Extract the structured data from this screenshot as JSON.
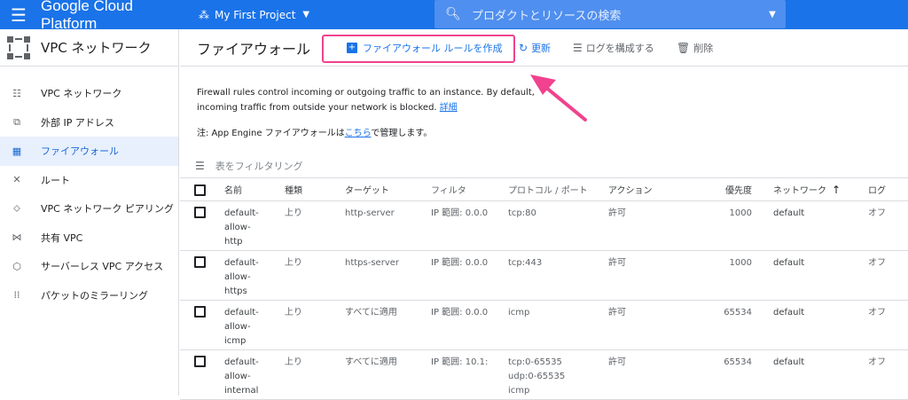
{
  "topbar": {
    "brand": "Google Cloud Platform",
    "project": "My First Project",
    "search_placeholder": "プロダクトとリソースの検索",
    "color": "#1a73e8"
  },
  "sidebar": {
    "title": "VPC ネットワーク",
    "items": [
      {
        "label": "VPC ネットワーク",
        "icon": "network-icon"
      },
      {
        "label": "外部 IP アドレス",
        "icon": "external-ip-icon"
      },
      {
        "label": "ファイアウォール",
        "icon": "firewall-icon"
      },
      {
        "label": "ルート",
        "icon": "route-icon"
      },
      {
        "label": "VPC ネットワーク ピアリング",
        "icon": "peering-icon"
      },
      {
        "label": "共有 VPC",
        "icon": "shared-vpc-icon"
      },
      {
        "label": "サーバーレス VPC アクセス",
        "icon": "serverless-icon"
      },
      {
        "label": "パケットのミラーリング",
        "icon": "mirroring-icon"
      }
    ]
  },
  "toolbar": {
    "title": "ファイアウォール",
    "create": "ファイアウォール ルールを作成",
    "refresh": "更新",
    "logs": "ログを構成する",
    "delete": "削除"
  },
  "info": {
    "text": "Firewall rules control incoming or outgoing traffic to an instance. By default, incoming traffic from outside your network is blocked.",
    "link": "詳細",
    "note_prefix": "注: App Engine ファイアウォールは",
    "note_link": "こちら",
    "note_suffix": "で管理します。"
  },
  "filter": {
    "placeholder": "表をフィルタリング"
  },
  "table": {
    "headers": [
      "名前",
      "種類",
      "ターゲット",
      "フィルタ",
      "プロトコル / ポート",
      "アクション",
      "優先度",
      "ネットワーク",
      "ログ"
    ],
    "rows": [
      {
        "name1": "default-",
        "name2": "allow-",
        "name3": "http",
        "type": "上り",
        "target": "http-server",
        "filter": "IP 範囲: 0.0.0",
        "proto1": "tcp:80",
        "proto2": "",
        "proto3": "",
        "action": "許可",
        "priority": "1000",
        "network": "default",
        "log": "オフ"
      },
      {
        "name1": "default-",
        "name2": "allow-",
        "name3": "https",
        "type": "上り",
        "target": "https-server",
        "filter": "IP 範囲: 0.0.0",
        "proto1": "tcp:443",
        "proto2": "",
        "proto3": "",
        "action": "許可",
        "priority": "1000",
        "network": "default",
        "log": "オフ"
      },
      {
        "name1": "default-",
        "name2": "allow-",
        "name3": "icmp",
        "type": "上り",
        "target": "すべてに適用",
        "filter": "IP 範囲: 0.0.0",
        "proto1": "icmp",
        "proto2": "",
        "proto3": "",
        "action": "許可",
        "priority": "65534",
        "network": "default",
        "log": "オフ"
      },
      {
        "name1": "default-",
        "name2": "allow-",
        "name3": "internal",
        "type": "上り",
        "target": "すべてに適用",
        "filter": "IP 範囲: 10.1:",
        "proto1": "tcp:0-65535",
        "proto2": "udp:0-65535",
        "proto3": "icmp",
        "action": "許可",
        "priority": "65534",
        "network": "default",
        "log": "オフ"
      }
    ]
  },
  "annotation": {
    "highlight_color": "#f0428e"
  }
}
